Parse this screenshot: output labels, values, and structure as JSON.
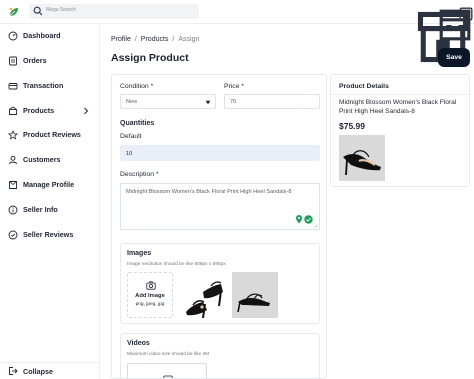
{
  "topbar": {
    "search_placeholder": "Mega Search",
    "icons": [
      "storefront-icon",
      "building-icon",
      "user-menu-icon"
    ]
  },
  "sidebar": {
    "items": [
      {
        "label": "Dashboard",
        "icon": "dashboard-icon"
      },
      {
        "label": "Orders",
        "icon": "orders-icon"
      },
      {
        "label": "Transaction",
        "icon": "transaction-icon"
      },
      {
        "label": "Products",
        "icon": "products-icon",
        "has_submenu": true
      },
      {
        "label": "Product Reviews",
        "icon": "star-icon"
      },
      {
        "label": "Customers",
        "icon": "customers-icon"
      },
      {
        "label": "Manage Profile",
        "icon": "profile-icon"
      },
      {
        "label": "Seller Info",
        "icon": "info-icon"
      },
      {
        "label": "Seller Reviews",
        "icon": "reviews-icon"
      }
    ],
    "collapse_label": "Collapse"
  },
  "breadcrumb": [
    "Profile",
    "Products",
    "Assign"
  ],
  "page_title": "Assign Product",
  "save_label": "Save",
  "form": {
    "condition_label": "Condition *",
    "condition_value": "New",
    "price_label": "Price *",
    "price_value": "70",
    "quantities_title": "Quantities",
    "default_label": "Default",
    "default_value": "10",
    "description_label": "Description *",
    "description_value": "Midnight Blossom Women's Black Floral Print High Heel Sandals-8",
    "images_title": "Images",
    "images_hint": "Image resolution should be like 609px x 590px",
    "add_image_label": "Add Image",
    "add_image_formats": "png, jpeg, jpg",
    "videos_title": "Videos",
    "videos_hint": "Maximum video size should be like 2M"
  },
  "details": {
    "title": "Product Details",
    "name": "Midnight Blossom Women's Black Floral Print High Heel Sandals-8",
    "price": "$75.99"
  },
  "colors": {
    "primary_dark": "#0b1728",
    "field_highlight": "#e9eef9",
    "accent_green": "#1e9e5a"
  }
}
